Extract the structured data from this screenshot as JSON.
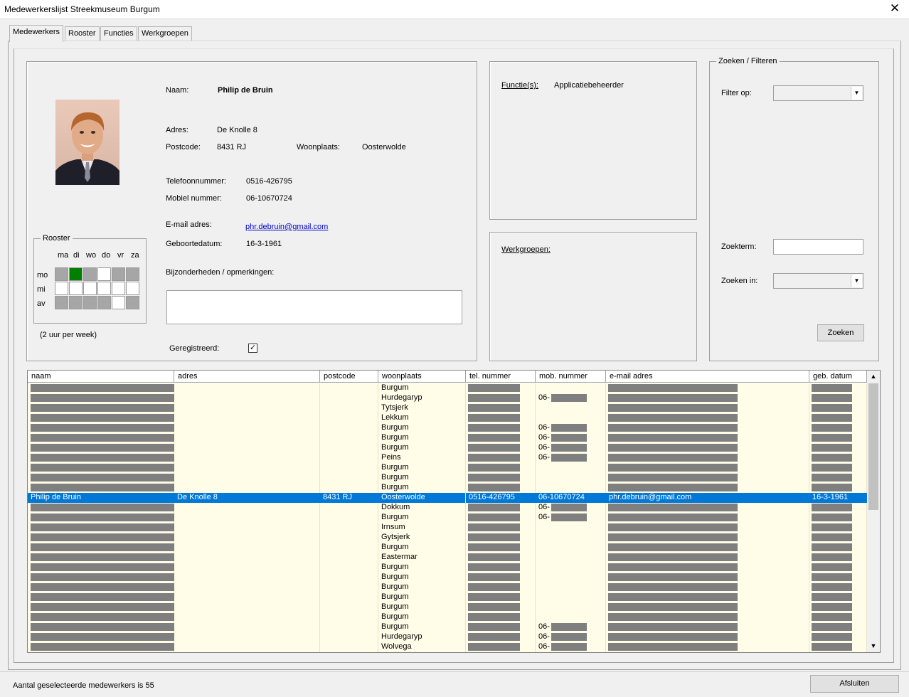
{
  "window": {
    "title": "Medewerkerslijst Streekmuseum Burgum",
    "close_glyph": "✕"
  },
  "tabs": [
    {
      "label": "Medewerkers",
      "active": true
    },
    {
      "label": "Rooster"
    },
    {
      "label": "Functies"
    },
    {
      "label": "Werkgroepen"
    }
  ],
  "details": {
    "naam_label": "Naam:",
    "naam": "Philip de Bruin",
    "adres_label": "Adres:",
    "adres": "De Knolle 8",
    "postcode_label": "Postcode:",
    "postcode": "8431 RJ",
    "woonplaats_label": "Woonplaats:",
    "woonplaats": "Oosterwolde",
    "telefoon_label": "Telefoonnummer:",
    "telefoon": "0516-426795",
    "mobiel_label": "Mobiel  nummer:",
    "mobiel": "06-10670724",
    "email_label": "E-mail adres:",
    "email": "phr.debruin@gmail.com",
    "geboorte_label": "Geboortedatum:",
    "geboorte": "16-3-1961",
    "bijzonderheden_label": "Bijzonderheden / opmerkingen:",
    "bijzonderheden": "",
    "geregistreerd_label": "Geregistreerd:",
    "geregistreerd": true
  },
  "rooster": {
    "legend": "Rooster",
    "days": [
      "ma",
      "di",
      "wo",
      "do",
      "vr",
      "za"
    ],
    "parts": [
      "mo",
      "mi",
      "av"
    ],
    "grid": [
      [
        "gray",
        "green",
        "gray",
        "white",
        "gray",
        "gray"
      ],
      [
        "white",
        "white",
        "white",
        "white",
        "white",
        "white"
      ],
      [
        "gray",
        "gray",
        "gray",
        "gray",
        "white",
        "gray"
      ]
    ],
    "hours": "(2 uur per week)"
  },
  "functies": {
    "label": "Functie(s):",
    "value": "Applicatiebeheerder"
  },
  "werkgroepen": {
    "label": "Werkgroepen:"
  },
  "search": {
    "legend": "Zoeken / Filteren",
    "filter_label": "Filter op:",
    "filter_value": "",
    "term_label": "Zoekterm:",
    "term_value": "",
    "in_label": "Zoeken in:",
    "in_value": "",
    "button": "Zoeken"
  },
  "table": {
    "columns": [
      "naam",
      "adres",
      "postcode",
      "woonplaats",
      "tel. nummer",
      "mob. nummer",
      "e-mail adres",
      "geb. datum"
    ],
    "rows": [
      {
        "woonplaats": "Burgum"
      },
      {
        "woonplaats": "Hurdegaryp",
        "mob": "06-"
      },
      {
        "woonplaats": "Tytsjerk"
      },
      {
        "woonplaats": "Lekkum"
      },
      {
        "woonplaats": "Burgum",
        "mob": "06-"
      },
      {
        "woonplaats": "Burgum",
        "mob": "06-"
      },
      {
        "woonplaats": "Burgum",
        "mob": "06-"
      },
      {
        "woonplaats": "Peins",
        "mob": "06-"
      },
      {
        "woonplaats": "Burgum"
      },
      {
        "woonplaats": "Burgum"
      },
      {
        "woonplaats": "Burgum"
      },
      {
        "selected": true,
        "naam": "Philip de Bruin",
        "adres": "De Knolle 8",
        "postcode": "8431 RJ",
        "woonplaats": "Oosterwolde",
        "tel": "0516-426795",
        "mob": "06-10670724",
        "email": "phr.debruin@gmail.com",
        "geb": "16-3-1961"
      },
      {
        "woonplaats": "Dokkum",
        "mob": "06-"
      },
      {
        "woonplaats": "Burgum",
        "mob": "06-"
      },
      {
        "woonplaats": "Irnsum"
      },
      {
        "woonplaats": "Gytsjerk"
      },
      {
        "woonplaats": "Burgum"
      },
      {
        "woonplaats": "Eastermar"
      },
      {
        "woonplaats": "Burgum"
      },
      {
        "woonplaats": "Burgum"
      },
      {
        "woonplaats": "Burgum"
      },
      {
        "woonplaats": "Burgum"
      },
      {
        "woonplaats": "Burgum"
      },
      {
        "woonplaats": "Burgum"
      },
      {
        "woonplaats": "Burgum",
        "mob": "06-"
      },
      {
        "woonplaats": "Hurdegaryp",
        "mob": "06-"
      },
      {
        "woonplaats": "Wolvega",
        "mob": "06-"
      }
    ]
  },
  "status": {
    "text": "Aantal geselecteerde medewerkers is 55",
    "close_button": "Afsluiten"
  },
  "colors": {
    "accent": "#0078d7",
    "row_bg": "#fffce8",
    "redaction": "#7f7f7f",
    "schedule_on": "#007f00"
  }
}
